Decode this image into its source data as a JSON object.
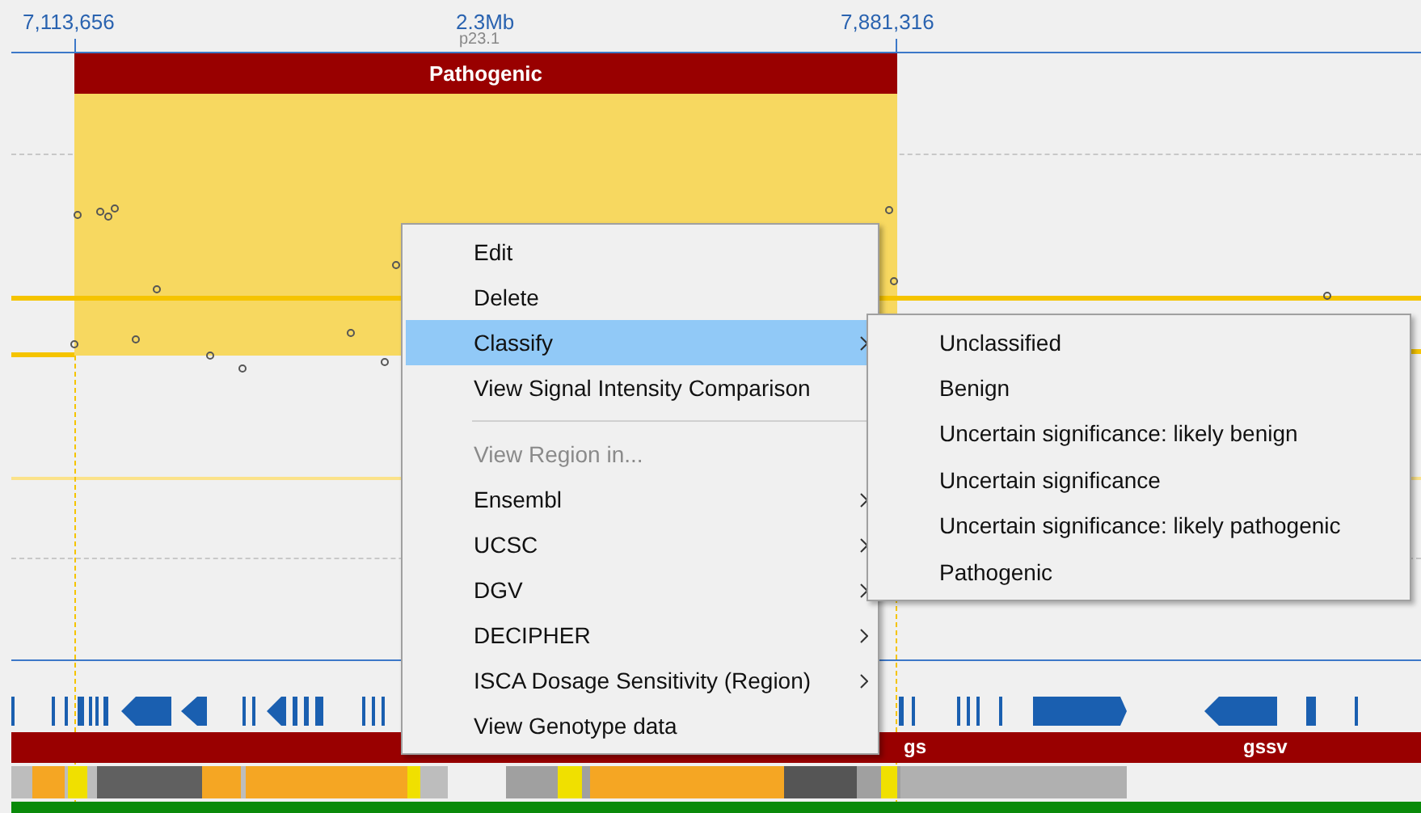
{
  "ruler": {
    "start": "7,113,656",
    "center": "2.3Mb",
    "band": "p23.1",
    "end": "7,881,316"
  },
  "region": {
    "label": "Pathogenic"
  },
  "track_labels": [
    "gs",
    "gssv"
  ],
  "context_menu": [
    {
      "kind": "item",
      "label": "Edit",
      "disabled": false,
      "selected": false,
      "has_submenu": false
    },
    {
      "kind": "item",
      "label": "Delete",
      "disabled": false,
      "selected": false,
      "has_submenu": false
    },
    {
      "kind": "item",
      "label": "Classify",
      "disabled": false,
      "selected": true,
      "has_submenu": true
    },
    {
      "kind": "item",
      "label": "View Signal Intensity Comparison",
      "disabled": false,
      "selected": false,
      "has_submenu": false
    },
    {
      "kind": "separator"
    },
    {
      "kind": "item",
      "label": "View Region in...",
      "disabled": true,
      "selected": false,
      "has_submenu": false
    },
    {
      "kind": "item",
      "label": "Ensembl",
      "disabled": false,
      "selected": false,
      "has_submenu": true
    },
    {
      "kind": "item",
      "label": "UCSC",
      "disabled": false,
      "selected": false,
      "has_submenu": true
    },
    {
      "kind": "item",
      "label": "DGV",
      "disabled": false,
      "selected": false,
      "has_submenu": true
    },
    {
      "kind": "item",
      "label": "DECIPHER",
      "disabled": false,
      "selected": false,
      "has_submenu": true
    },
    {
      "kind": "item",
      "label": "ISCA Dosage Sensitivity (Region)",
      "disabled": false,
      "selected": false,
      "has_submenu": true
    },
    {
      "kind": "item",
      "label": "View Genotype data",
      "disabled": false,
      "selected": false,
      "has_submenu": false
    }
  ],
  "submenu": [
    {
      "label": "Unclassified",
      "selected": false
    },
    {
      "label": "Benign",
      "selected": false
    },
    {
      "label": "Uncertain significance: likely benign",
      "selected": false
    },
    {
      "label": "Uncertain significance",
      "selected": false
    },
    {
      "label": "Uncertain significance: likely pathogenic",
      "selected": false
    },
    {
      "label": "Pathogenic",
      "selected": false
    }
  ]
}
